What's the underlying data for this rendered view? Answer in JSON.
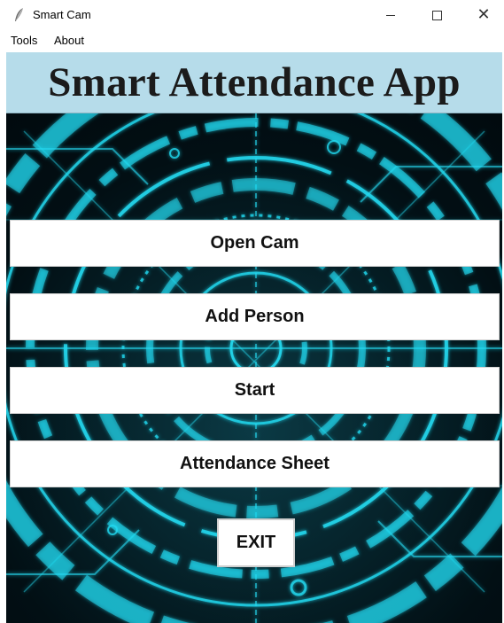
{
  "window": {
    "title": "Smart Cam",
    "icon": "feather-icon"
  },
  "menu": {
    "items": [
      "Tools",
      "About"
    ]
  },
  "header": {
    "title": "Smart Attendance App",
    "background": "#b6dcea"
  },
  "buttons": {
    "open_cam": "Open Cam",
    "add_person": "Add Person",
    "start": "Start",
    "attendance_sheet": "Attendance Sheet",
    "exit": "EXIT"
  },
  "theme": {
    "accent": "#1fd6ee",
    "background": "#031a20"
  }
}
